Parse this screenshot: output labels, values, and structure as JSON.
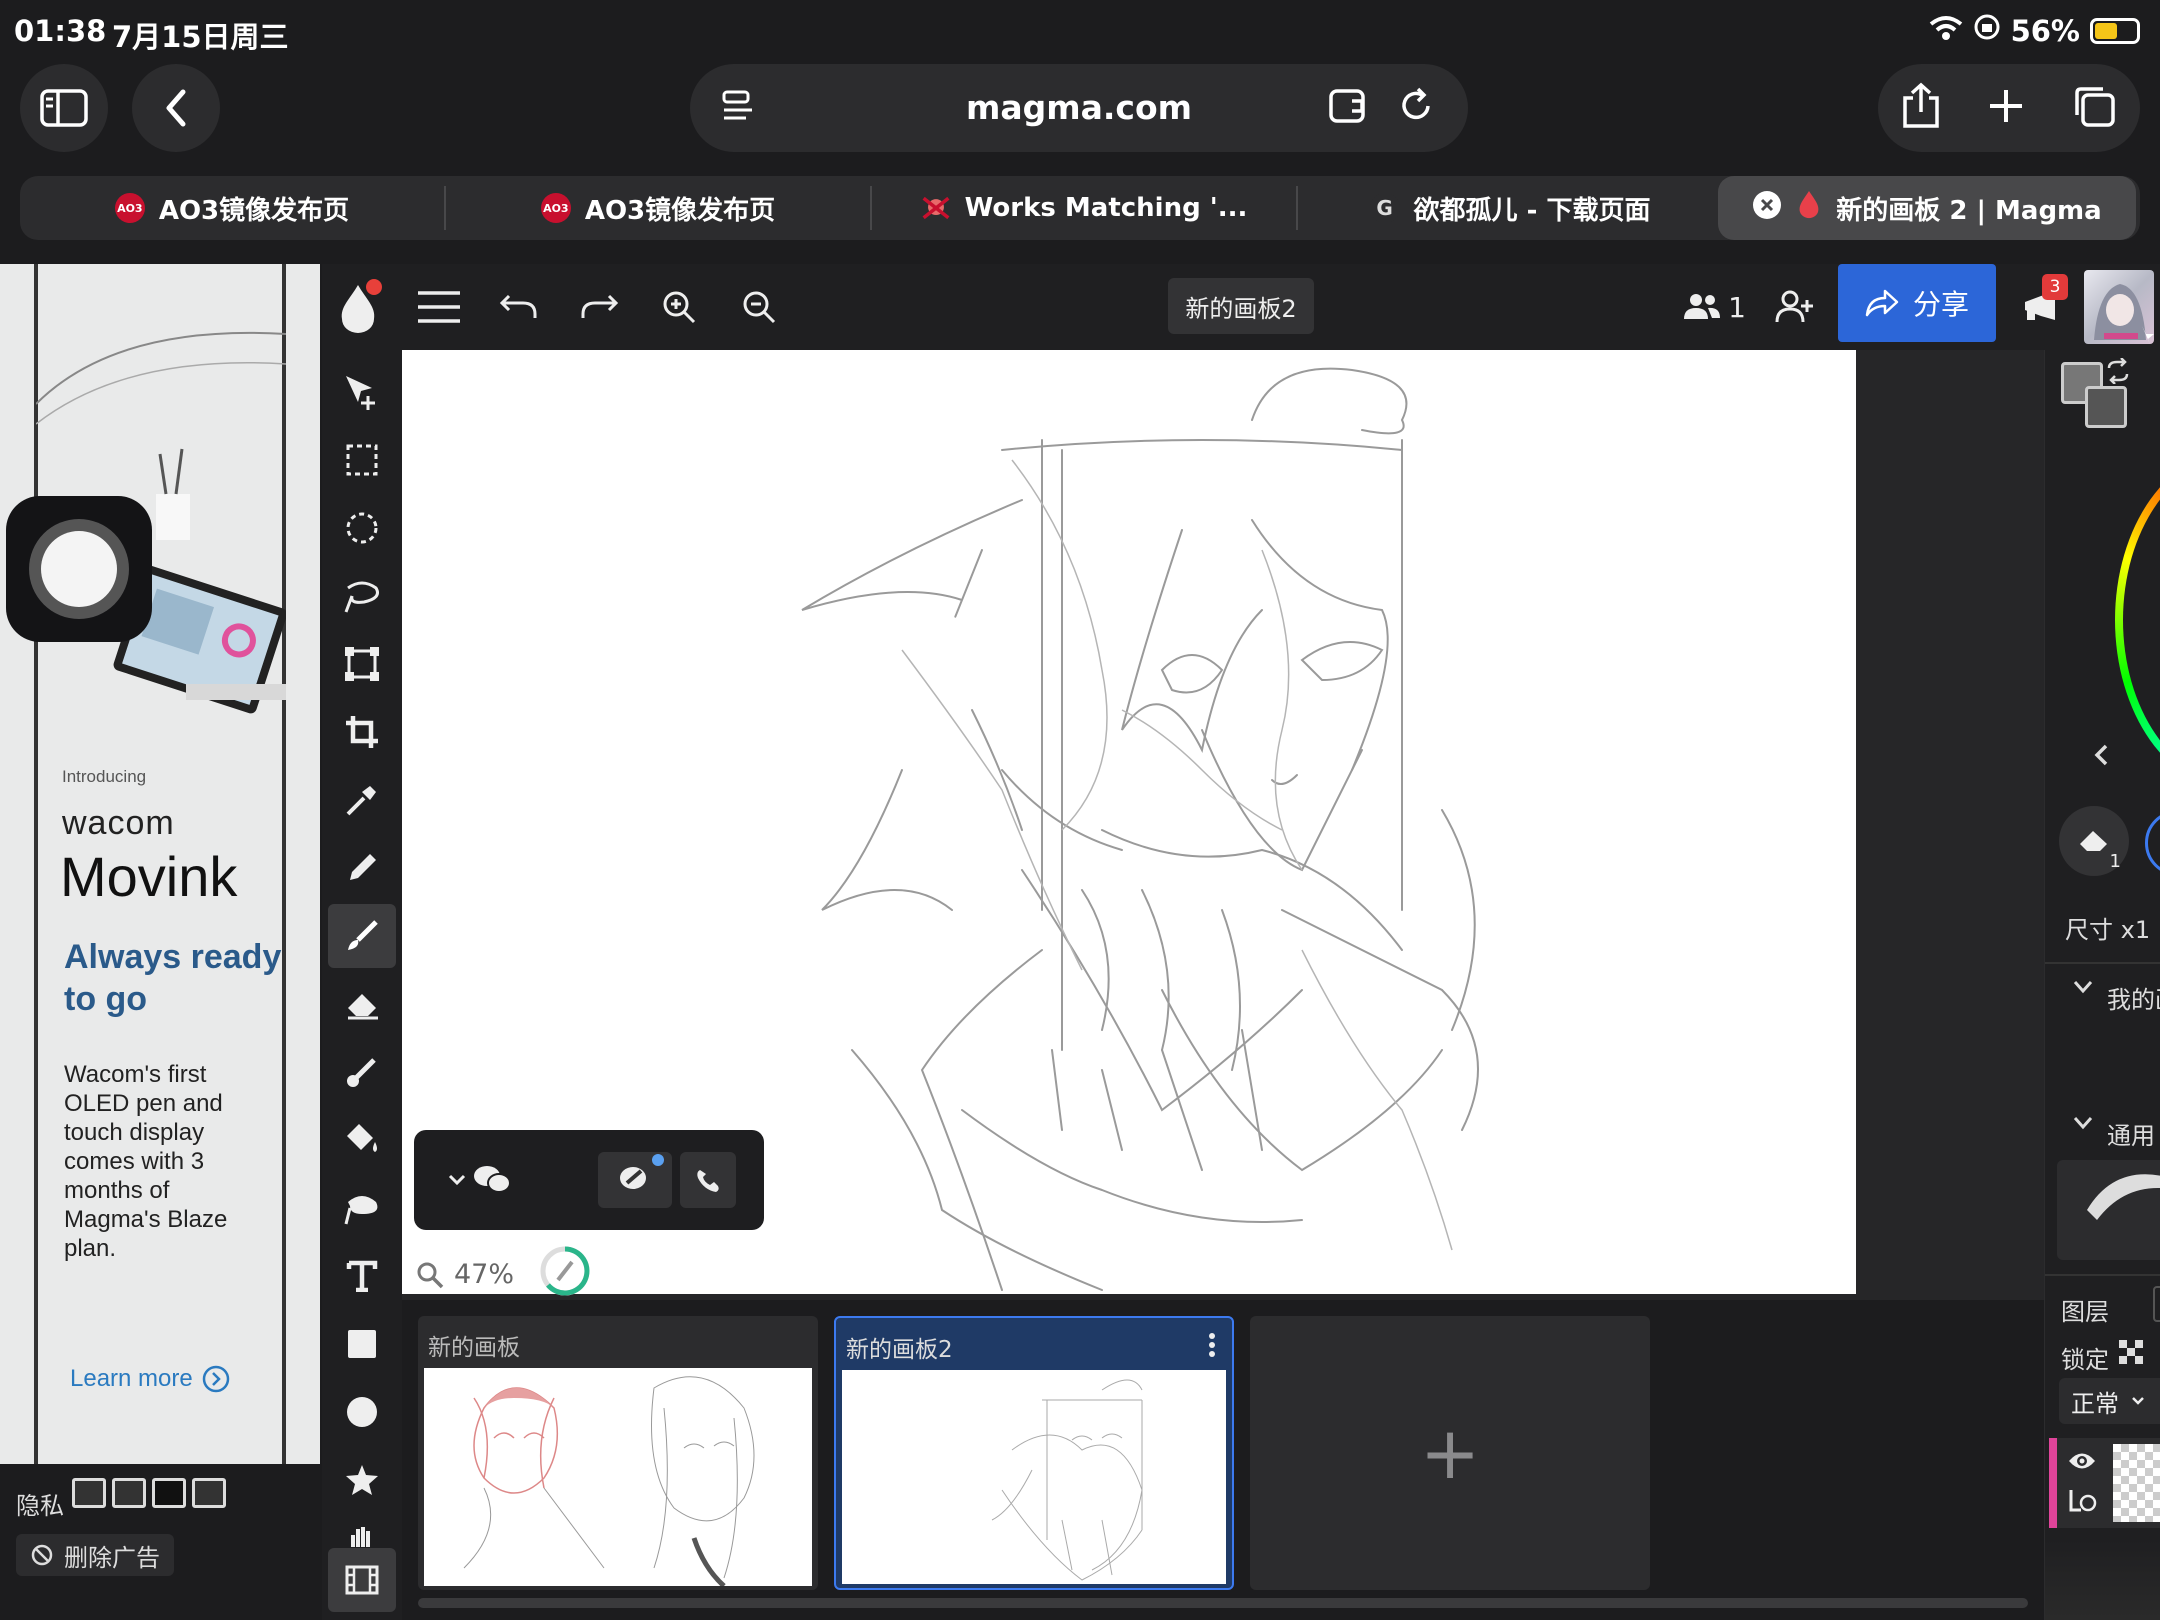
{
  "status_bar": {
    "time": "01:38",
    "date": "7月15日周三",
    "battery": "56%",
    "battery_level": 0.56
  },
  "browser": {
    "url": "magma.com",
    "tabs": [
      {
        "label": "AO3镜像发布页",
        "favicon": "AO3"
      },
      {
        "label": "AO3镜像发布页",
        "favicon": "AO3"
      },
      {
        "label": "Works Matching '...",
        "favicon": ""
      },
      {
        "label": "欲都孤儿 - 下载页面",
        "favicon": "G"
      },
      {
        "label": "新的画板 2 | Magma",
        "favicon": "",
        "active": true
      }
    ]
  },
  "ad": {
    "intro": "Introducing",
    "brand": "wacom",
    "product": "Movink",
    "tagline": "Always ready to go",
    "description": "Wacom's first OLED pen and touch display comes with 3 months of Magma's Blaze plan.",
    "cta": "Learn more",
    "privacy_label": "隐私",
    "remove_ads": "删除广告"
  },
  "app": {
    "board_title": "新的画板2",
    "users_count": "1",
    "share_label": "分享",
    "notifications": "3",
    "zoom": "47%",
    "accent": "#2c66d8",
    "boards": [
      {
        "name": "新的画板"
      },
      {
        "name": "新的画板2"
      }
    ],
    "add_board": "+"
  },
  "right_panel": {
    "size_label": "尺寸 x1",
    "eraser_count": "1",
    "my_brushes": "我的画",
    "general": "通用",
    "layers": "图层",
    "lock": "锁定",
    "blend": "正常"
  }
}
